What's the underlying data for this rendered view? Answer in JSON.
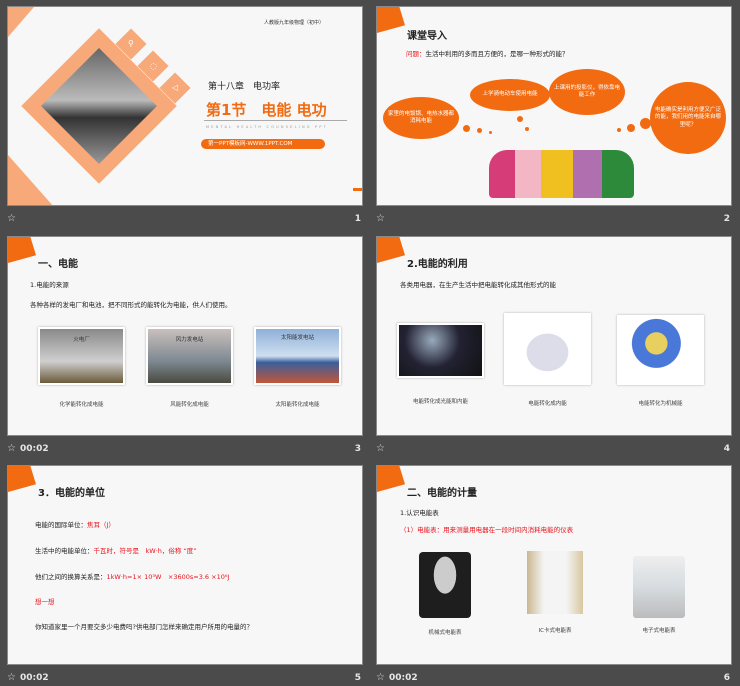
{
  "slides": [
    {
      "number": "1",
      "time": "",
      "title_top": "人教版九年级物理（初中）",
      "chapter": "第十八章　电功率",
      "section": "第1节　电能 电功",
      "subtitle": "MENTAL HEALTH COUNSELING PPT",
      "link": "第一PPT模板网-WWW.1PPT.COM"
    },
    {
      "number": "2",
      "time": "",
      "title": "课堂导入",
      "question_label": "问题：",
      "question": "生活中利用的多而且方便的，是哪一种形式的能？",
      "clouds": [
        "家里的电饭锅、电热水器都消耗电能",
        "上学骑电动车使用电能",
        "上课用的投影仪，得依靠电能工作",
        "电能确实是利用方便又广泛的能，我们用的电能来自哪里呢？"
      ]
    },
    {
      "number": "3",
      "time": "00:02",
      "title": "一、电能",
      "sub": "1.电能的来源",
      "text": "各种各样的发电厂和电池，把不同形式的能转化为电能，供人们使用。",
      "photos": [
        {
          "label": "火电厂",
          "caption": "化学能转化成电能"
        },
        {
          "label": "风力发电站",
          "caption": "风能转化成电能"
        },
        {
          "label": "太阳能发电站",
          "caption": "太阳能转化成电能"
        }
      ]
    },
    {
      "number": "4",
      "time": "",
      "title": "2.电能的利用",
      "text": "各类用电器，在生产生活中把电能转化成其他形式的能",
      "captions": [
        "电能转化成光能和内能",
        "电能转化成内能",
        "电能转化为机械能"
      ]
    },
    {
      "number": "5",
      "time": "00:02",
      "title": "3．电能的单位",
      "l1_label": "电能的国际单位：",
      "l1_value": "焦耳（J）",
      "l2_label": "生活中的电能单位：",
      "l2_value": "千瓦时，符号是　kW·h，俗称 “度”",
      "l3_label": "他们之间的换算关系是：",
      "l3_value": "1kW·h=1× 10³W　×3600s=3.6 ×10⁶J",
      "think": "想一想",
      "question": "你知道家里一个月要交多少电费吗?供电部门怎样来确定用户所用的电量的？"
    },
    {
      "number": "6",
      "time": "00:02",
      "title": "二、电能的计量",
      "sub": "1.认识电能表",
      "def": "（1）电能表：用来测量用电器在一段时间内消耗电能的仪表",
      "captions": [
        "机械式电能表",
        "IC卡式电能表",
        "电子式电能表"
      ]
    }
  ],
  "colors": {
    "accent": "#f26b11",
    "background": "#4b4b4b",
    "slide": "#f7f7f7",
    "red": "#e8141d"
  },
  "icons": {
    "transition": "star-icon"
  }
}
